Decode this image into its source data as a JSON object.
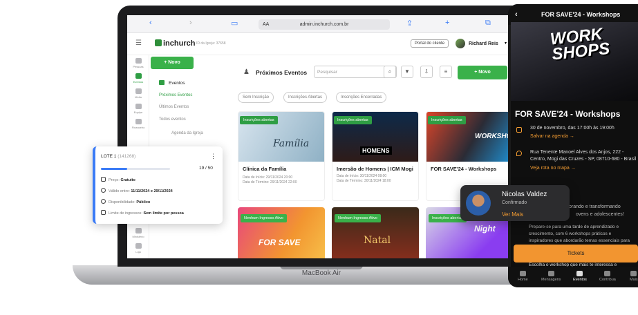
{
  "browser": {
    "url": "admin.inchurch.com.br",
    "aa": "AA"
  },
  "app": {
    "logo": "inchurch",
    "igreja_id": "ID da Igreja: 37658",
    "portal": "Portal do cliente",
    "user": "Richard Reis"
  },
  "rail": [
    "Pessoas",
    "Eventos",
    "Mídia",
    "Equipe",
    "Financeiro",
    "Relatório",
    "Ministério",
    "Loja"
  ],
  "side": {
    "new": "+ Novo",
    "section": "Eventos",
    "items": [
      "Próximos Eventos",
      "Últimos Eventos",
      "Todos eventos",
      "Agenda da Igreja"
    ]
  },
  "main": {
    "title": "Próximos Eventos",
    "search_placeholder": "Pesquisar",
    "new": "+ Novo",
    "chips": [
      "Sem Inscrição",
      "Inscrições Abertas",
      "Inscrições Encerradas"
    ],
    "cards": [
      {
        "badge": "Inscrições abertas",
        "title": "Clínica da Família",
        "d1": "Data de Início: 29/11/2024 20:00",
        "d2": "Data de Término: 29/11/2024 22:00",
        "thumbtext": "Família"
      },
      {
        "badge": "Inscrições abertas",
        "title": "Imersão de Homens | ICM Mogi",
        "d1": "Data de Início: 30/11/2024 08:00",
        "d2": "Data de Término: 30/11/2024 18:00",
        "thumbtext": "HOMENS"
      },
      {
        "badge": "Inscrições abertas",
        "title": "FOR SAVE'24 - Workshops",
        "d1": "Data de Início: 30/11/2024 17:00",
        "d2": "Data de Término: 30/11/2024 19:00",
        "thumbtext": "WORKSHOPS"
      }
    ],
    "cards2": [
      {
        "badge": "Nenhum Ingresso Ativo",
        "thumbtext": "FOR SAVE"
      },
      {
        "badge": "Nenhum Ingresso Ativo",
        "thumbtext": "Natal"
      },
      {
        "badge": "Inscrições abertas",
        "thumbtext": "Night"
      }
    ]
  },
  "lote": {
    "title": "LOTE 1",
    "id": "(141268)",
    "count": "19 / 50",
    "progress": 0.38,
    "rows": [
      {
        "label": "Preço:",
        "value": "Gratuito"
      },
      {
        "label": "Válido entre:",
        "value": "11/11/2024 e 29/11/2024"
      },
      {
        "label": "Disponibilidade:",
        "value": "Público"
      },
      {
        "label": "Limite de ingressos:",
        "value": "Sem limite por pessoa"
      }
    ]
  },
  "laptop": {
    "label": "MacBook Air"
  },
  "phone": {
    "header": "FOR SAVE'24 - Workshops",
    "hero": "WORK SHOPS",
    "title": "FOR SAVE'24 - Workshops",
    "date": "30 de novembro, das 17:00h às 19:00h",
    "save": "Salvar na agenda →",
    "address": "Rua Tenente Manoel Alves dos Anjos, 222 - Centro, Mogi das Cruzes - SP, 08710-680 - Brasil",
    "map": "Veja rota no mapa →",
    "desc1": "orando e transformando",
    "desc2": "ovens e adolescentes!",
    "desc3": "Prepare-se para uma tarde de aprendizado e",
    "desc4": "crescimento, com 6 workshops práticos e",
    "desc5": "inspiradores que abordarão temas essenciais para",
    "tickets": "Tickets",
    "footer1": "Escolha o workshop que mais te interessa e",
    "tabs": [
      "Home",
      "Mensagens",
      "Eventos",
      "Contribua",
      "Mais"
    ]
  },
  "popup": {
    "name": "Nicolas Valdez",
    "status": "Confirmado",
    "link": "Ver Mais"
  }
}
